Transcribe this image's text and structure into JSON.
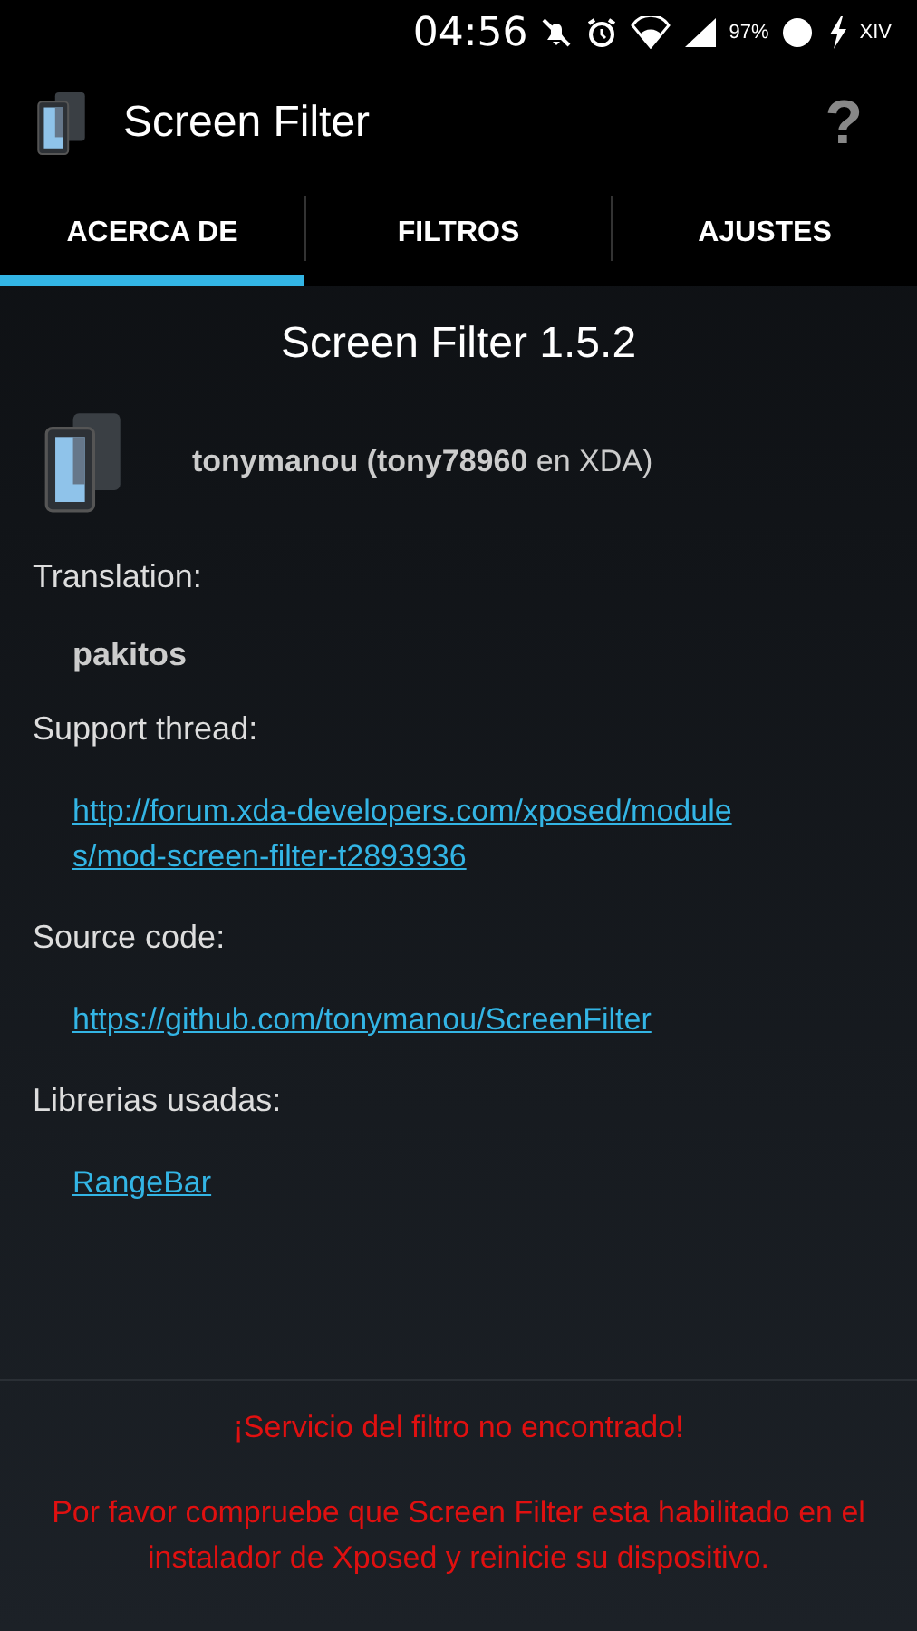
{
  "status_bar": {
    "time": "04:56",
    "battery": "97%",
    "carrier": "XIV"
  },
  "action_bar": {
    "title": "Screen Filter",
    "help": "?"
  },
  "tabs": [
    {
      "label": "ACERCA DE",
      "selected": true
    },
    {
      "label": "FILTROS",
      "selected": false
    },
    {
      "label": "AJUSTES",
      "selected": false
    }
  ],
  "about": {
    "title": "Screen Filter 1.5.2",
    "author": "**tonymanou (tony78960** en XDA)",
    "sections": [
      {
        "kind": "heading",
        "text": "Translation:"
      },
      {
        "kind": "name",
        "text": "pakitos"
      },
      {
        "kind": "heading",
        "text": "Support thread:"
      },
      {
        "kind": "link",
        "text": "http://forum.xda-developers.com/xposed/modules/mod-screen-filter-t2893936"
      },
      {
        "kind": "heading",
        "text": "Source code:"
      },
      {
        "kind": "link",
        "text": "https://github.com/tonymanou/ScreenFilter"
      },
      {
        "kind": "heading",
        "text": "Librerias usadas:"
      },
      {
        "kind": "link",
        "text": "RangeBar"
      }
    ]
  },
  "warning": {
    "title": "¡Servicio del filtro no encontrado!",
    "message": "Por favor compruebe que Screen Filter esta habilitado en el instalador de Xposed y reinicie su dispositivo."
  }
}
